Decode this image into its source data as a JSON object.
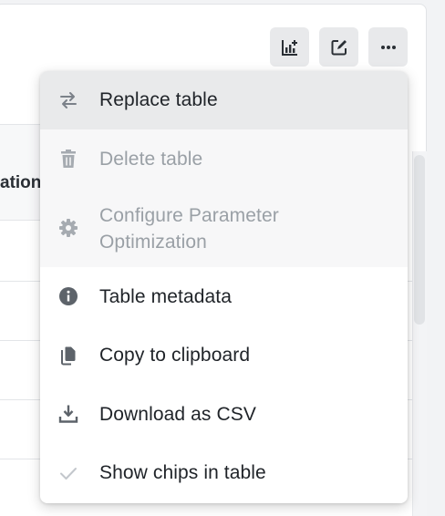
{
  "toolbar": {
    "buttons": [
      {
        "icon": "add-chart-icon"
      },
      {
        "icon": "edit-icon"
      },
      {
        "icon": "more-horizontal-icon"
      }
    ]
  },
  "table": {
    "partial_header": "ation"
  },
  "menu": {
    "items": [
      {
        "label": "Replace table",
        "icon": "swap-arrows-icon",
        "state": "active"
      },
      {
        "label": "Delete table",
        "icon": "trash-icon",
        "state": "disabled"
      },
      {
        "label": "Configure Parameter",
        "label_line2": "Optimization",
        "icon": "gear-icon",
        "state": "disabled"
      },
      {
        "label": "Table metadata",
        "icon": "info-icon",
        "state": "enabled"
      },
      {
        "label": "Copy to clipboard",
        "icon": "copy-icon",
        "state": "enabled"
      },
      {
        "label": "Download as CSV",
        "icon": "download-icon",
        "state": "enabled"
      },
      {
        "label": "Show chips in table",
        "icon": "check-icon",
        "state": "enabled"
      }
    ]
  },
  "colors": {
    "active_bg": "#e9eaeb",
    "disabled_bg": "#f7f7f8",
    "disabled_text": "#9aa0a6",
    "text": "#1f2328",
    "icon": "#555b62"
  }
}
